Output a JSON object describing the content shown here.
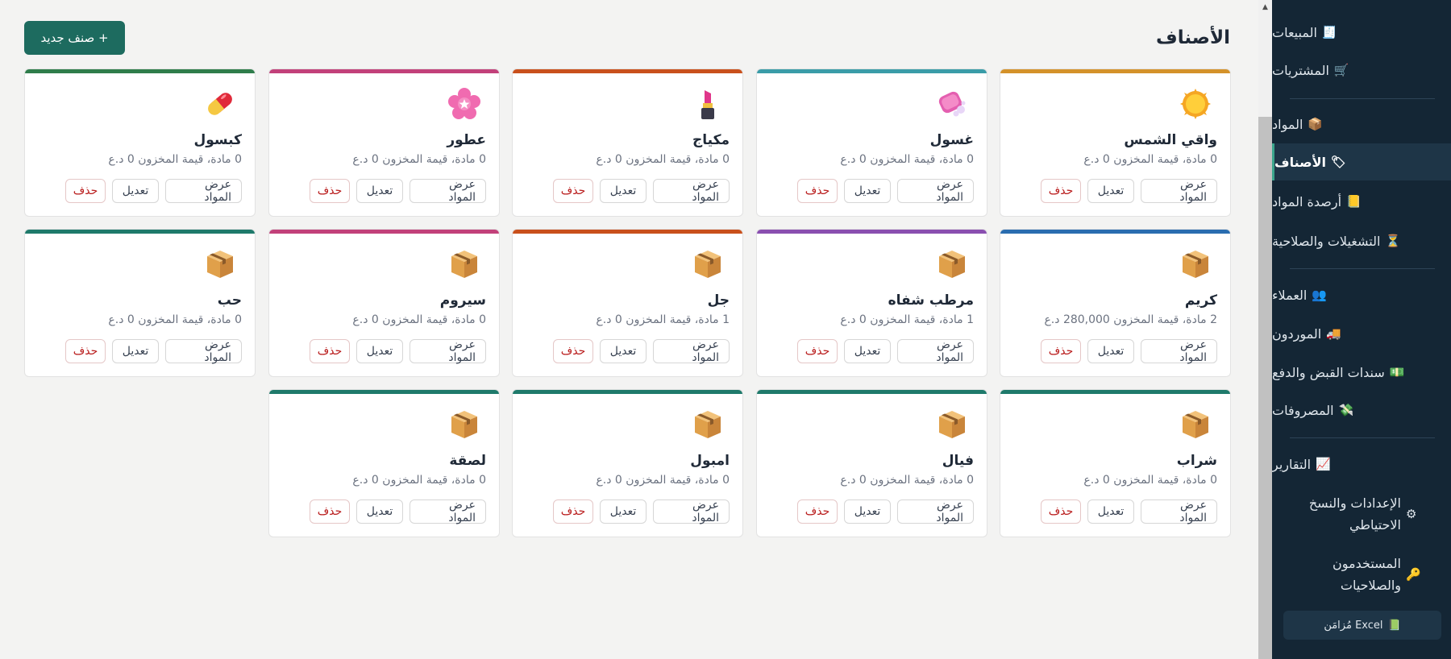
{
  "page": {
    "title": "الأصناف",
    "new_button": "+ صنف جديد"
  },
  "sidebar": {
    "items": [
      {
        "label": "المبيعات",
        "icon": "receipt-icon",
        "glyph": "🧾"
      },
      {
        "label": "المشتريات",
        "icon": "cart-icon",
        "glyph": "🛒"
      },
      {
        "label": "المواد",
        "icon": "box-icon",
        "glyph": "📦"
      },
      {
        "label": "الأصناف",
        "icon": "tag-icon",
        "glyph": "🏷",
        "active": true
      },
      {
        "label": "أرصدة المواد",
        "icon": "ledger-icon",
        "glyph": "📒"
      },
      {
        "label": "التشغيلات والصلاحية",
        "icon": "hourglass-icon",
        "glyph": "⏳"
      },
      {
        "label": "العملاء",
        "icon": "users-icon",
        "glyph": "👥"
      },
      {
        "label": "الموردون",
        "icon": "truck-icon",
        "glyph": "🚚"
      },
      {
        "label": "سندات القبض والدفع",
        "icon": "money-icon",
        "glyph": "💵"
      },
      {
        "label": "المصروفات",
        "icon": "flying-money-icon",
        "glyph": "💸"
      },
      {
        "label": "التقارير",
        "icon": "chart-icon",
        "glyph": "📈"
      },
      {
        "label": "الإعدادات والنسخ الاحتياطي",
        "icon": "gear-icon",
        "glyph": "⚙"
      },
      {
        "label": "المستخدمون والصلاحيات",
        "icon": "key-icon",
        "glyph": "🔑"
      }
    ],
    "excel_label": "Excel مُزامَن",
    "excel_glyph": "📗"
  },
  "card_buttons": {
    "view": "عرض المواد",
    "edit": "تعديل",
    "delete": "حذف"
  },
  "cards": [
    {
      "name": "واقي الشمس",
      "meta": "0 مادة، قيمة المخزون 0 د.ع",
      "color": "#d4922a",
      "icon": "sun-icon"
    },
    {
      "name": "غسول",
      "meta": "0 مادة، قيمة المخزون 0 د.ع",
      "color": "#3a9ca8",
      "icon": "soap-icon"
    },
    {
      "name": "مكياج",
      "meta": "0 مادة، قيمة المخزون 0 د.ع",
      "color": "#c9501c",
      "icon": "lipstick-icon"
    },
    {
      "name": "عطور",
      "meta": "0 مادة، قيمة المخزون 0 د.ع",
      "color": "#c2417a",
      "icon": "blossom-icon"
    },
    {
      "name": "كبسول",
      "meta": "0 مادة، قيمة المخزون 0 د.ع",
      "color": "#2f7d4b",
      "icon": "pill-icon"
    },
    {
      "name": "كريم",
      "meta": "2 مادة، قيمة المخزون 280,000 د.ع",
      "color": "#2a6db0",
      "icon": "package-icon"
    },
    {
      "name": "مرطب شفاه",
      "meta": "1 مادة، قيمة المخزون 0 د.ع",
      "color": "#8a4fb0",
      "icon": "package-icon"
    },
    {
      "name": "جل",
      "meta": "1 مادة، قيمة المخزون 0 د.ع",
      "color": "#c9501c",
      "icon": "package-icon"
    },
    {
      "name": "سيروم",
      "meta": "0 مادة، قيمة المخزون 0 د.ع",
      "color": "#c2417a",
      "icon": "package-icon"
    },
    {
      "name": "حب",
      "meta": "0 مادة، قيمة المخزون 0 د.ع",
      "color": "#1f7a6b",
      "icon": "package-icon"
    },
    {
      "name": "شراب",
      "meta": "0 مادة، قيمة المخزون 0 د.ع",
      "color": "#1f7a6b",
      "icon": "package-icon"
    },
    {
      "name": "فيال",
      "meta": "0 مادة، قيمة المخزون 0 د.ع",
      "color": "#1f7a6b",
      "icon": "package-icon"
    },
    {
      "name": "امبول",
      "meta": "0 مادة، قيمة المخزون 0 د.ع",
      "color": "#1f7a6b",
      "icon": "package-icon"
    },
    {
      "name": "لصقة",
      "meta": "0 مادة، قيمة المخزون 0 د.ع",
      "color": "#1f7a6b",
      "icon": "package-icon"
    }
  ]
}
